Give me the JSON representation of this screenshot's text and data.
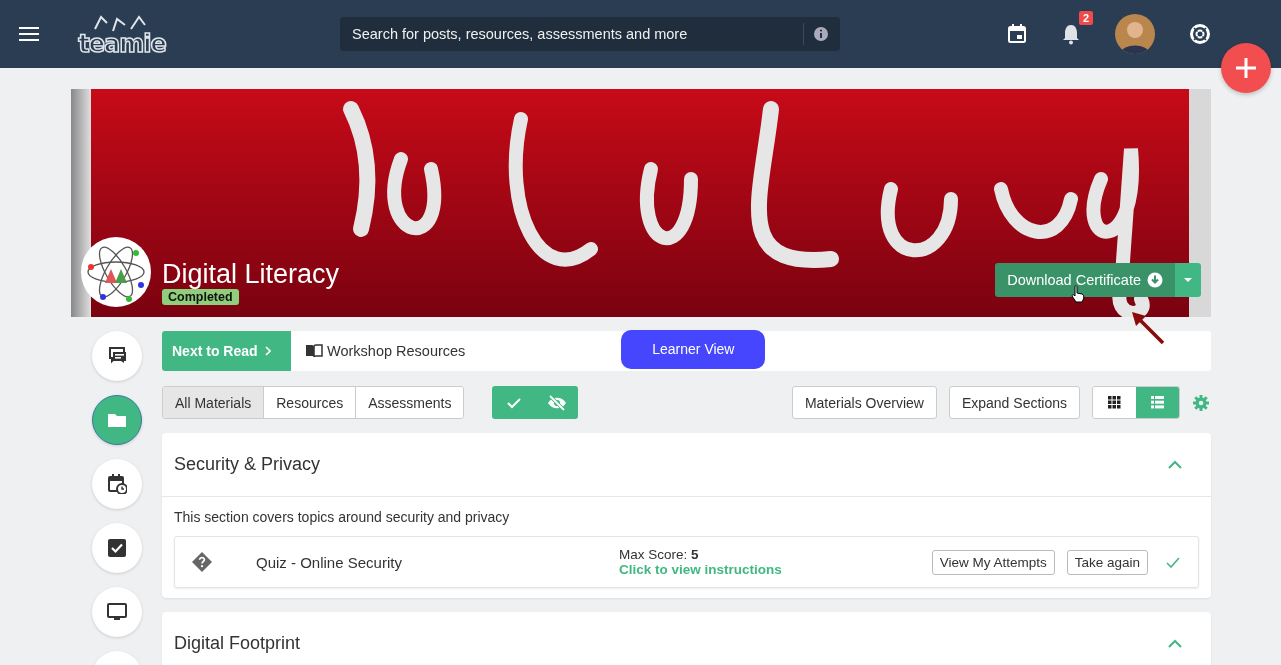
{
  "header": {
    "logo": "teamie",
    "search": {
      "placeholder": "Search for posts, resources, assessments and more"
    },
    "notifications": {
      "count": "2"
    }
  },
  "course": {
    "title": "Digital Literacy",
    "status": "Completed",
    "download_button": {
      "label": "Download Certificate"
    }
  },
  "sidebar": {
    "items": [
      {
        "kind": "discussion",
        "selected": false
      },
      {
        "kind": "folder",
        "selected": true
      },
      {
        "kind": "schedule",
        "selected": false
      },
      {
        "kind": "checkbox",
        "selected": false
      },
      {
        "kind": "monitor",
        "selected": false
      },
      {
        "kind": "more",
        "selected": false
      }
    ]
  },
  "next_to_read": {
    "label": "Next to Read",
    "resource": "Workshop Resources"
  },
  "learner_view_button": {
    "label": "Learner View"
  },
  "filters": [
    {
      "label": "All Materials",
      "selected": true
    },
    {
      "label": "Resources",
      "selected": false
    },
    {
      "label": "Assessments",
      "selected": false
    }
  ],
  "actions": [
    "Materials Overview",
    "Expand Sections"
  ],
  "view_modes": [
    {
      "kind": "grid",
      "selected": false
    },
    {
      "kind": "list",
      "selected": true
    }
  ],
  "sections": [
    {
      "title": "Security & Privacy",
      "expanded": true,
      "description": "This section covers topics around security and privacy",
      "items": [
        {
          "kind": "quiz",
          "title": "Quiz - Online Security",
          "score": "Max Score: **5**",
          "instructions_link": "Click to view instructions",
          "buttons": [
            "View My Attempts",
            "Take again"
          ],
          "completed": true
        }
      ]
    },
    {
      "title": "Digital Footprint",
      "expanded": true
    }
  ]
}
